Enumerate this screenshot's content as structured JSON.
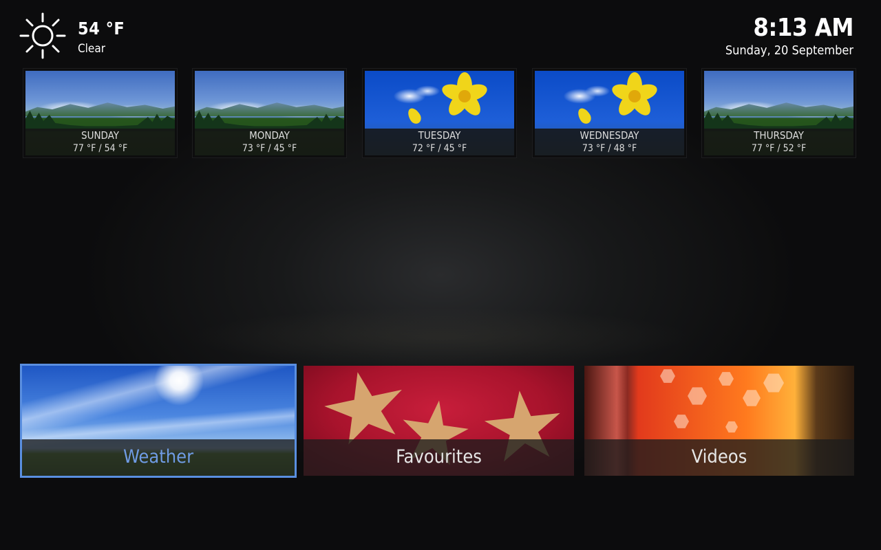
{
  "current_weather": {
    "icon": "sun-icon",
    "temperature": "54 °F",
    "condition": "Clear"
  },
  "clock": {
    "time": "8:13 AM",
    "date": "Sunday, 20 September"
  },
  "forecast": [
    {
      "day": "SUNDAY",
      "temps": "77 °F / 54 °F",
      "scene": "mountain"
    },
    {
      "day": "MONDAY",
      "temps": "73 °F / 45 °F",
      "scene": "mountain"
    },
    {
      "day": "TUESDAY",
      "temps": "72 °F / 45 °F",
      "scene": "flower"
    },
    {
      "day": "WEDNESDAY",
      "temps": "73 °F / 48 °F",
      "scene": "flower"
    },
    {
      "day": "THURSDAY",
      "temps": "77 °F / 52 °F",
      "scene": "mountain"
    }
  ],
  "menu": [
    {
      "label": "Weather",
      "focused": true
    },
    {
      "label": "Favourites",
      "focused": false
    },
    {
      "label": "Videos",
      "focused": false
    }
  ],
  "colors": {
    "focus_accent": "#5a8fe0",
    "focus_text": "#6f9be4"
  }
}
